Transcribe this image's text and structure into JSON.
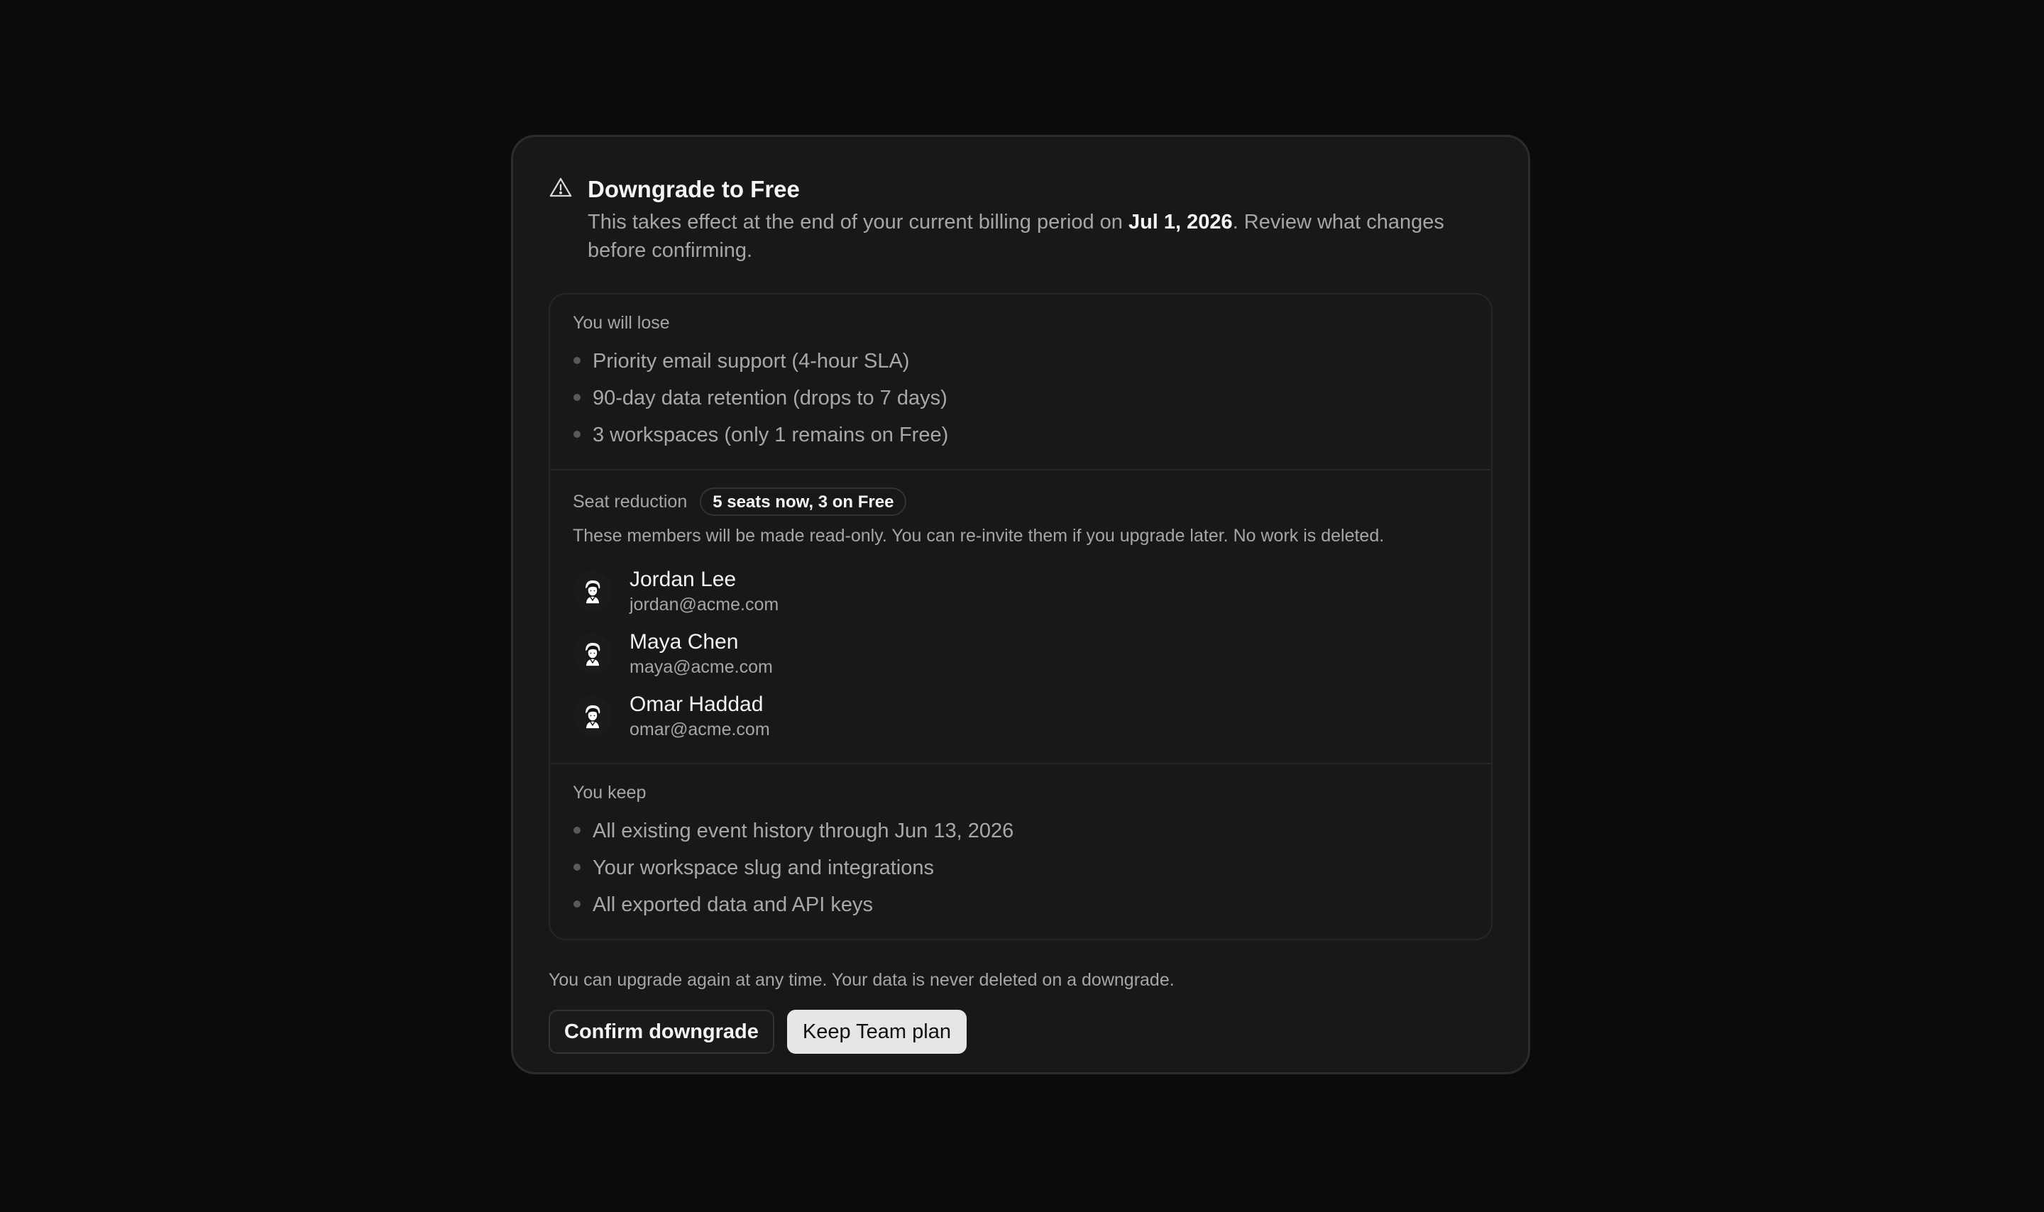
{
  "dialog": {
    "title": "Downgrade to Free",
    "subtitle_pre": "This takes effect at the end of your current billing period on ",
    "subtitle_date": "Jul 1, 2026",
    "subtitle_post": ". Review what changes before confirming.",
    "icon": "warning-triangle-icon"
  },
  "lose": {
    "label": "You will lose",
    "items": [
      "Priority email support (4-hour SLA)",
      "90-day data retention (drops to 7 days)",
      "3 workspaces (only 1 remains on Free)"
    ]
  },
  "seats": {
    "label": "Seat reduction",
    "badge": "5 seats now, 3 on Free",
    "note": "These members will be made read-only. You can re-invite them if you upgrade later. No work is deleted.",
    "members": [
      {
        "name": "Jordan Lee",
        "email": "jordan@acme.com"
      },
      {
        "name": "Maya Chen",
        "email": "maya@acme.com"
      },
      {
        "name": "Omar Haddad",
        "email": "omar@acme.com"
      }
    ]
  },
  "keep": {
    "label": "You keep",
    "items": [
      "All existing event history through Jun 13, 2026",
      "Your workspace slug and integrations",
      "All exported data and API keys"
    ]
  },
  "footer": {
    "note": "You can upgrade again at any time. Your data is never deleted on a downgrade.",
    "confirm_label": "Confirm downgrade",
    "keep_label": "Keep Team plan"
  }
}
